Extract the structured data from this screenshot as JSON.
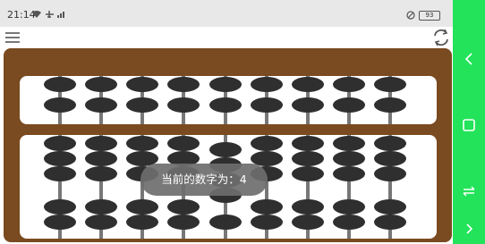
{
  "status_bar": {
    "time": "21:14",
    "left_icons": [
      "wifi-icon",
      "airplane-icon",
      "signal-icon"
    ],
    "right_icons": [
      "do-not-disturb-icon",
      "battery-icon"
    ],
    "battery_level": "93"
  },
  "app_bar": {
    "left_icon": "menu-icon",
    "right_icon": "refresh-icon"
  },
  "abacus": {
    "rods": 9,
    "frame_color": "#7a4a20",
    "bead_color": "#2f2f2f",
    "upper_beads_per_rod": 2,
    "lower_beads_per_rod": 5
  },
  "toast": {
    "text": "当前的数字为：4"
  },
  "nav_bar": {
    "color": "#22e35a",
    "buttons": [
      "back-icon",
      "home-icon",
      "switch-icon",
      "down-icon"
    ]
  }
}
